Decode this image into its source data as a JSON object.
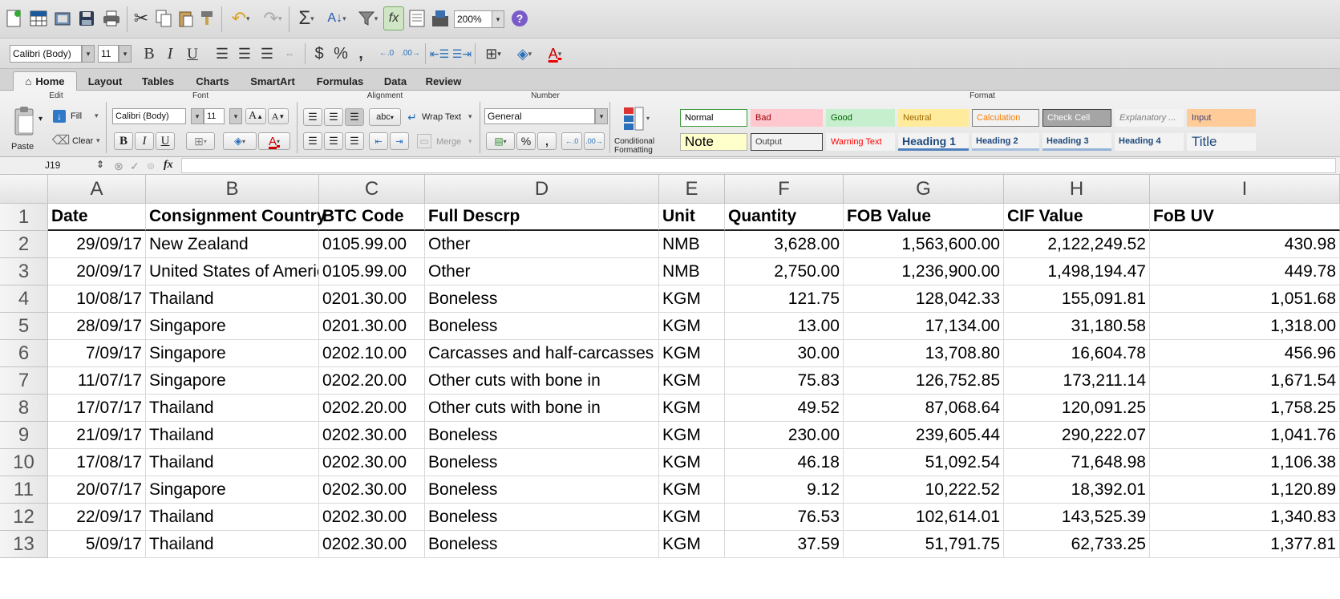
{
  "toolbar": {
    "zoom": "200%",
    "icons": [
      "new-doc-icon",
      "template-gallery-icon",
      "open-icon",
      "save-icon",
      "print-icon",
      "cut-icon",
      "copy-icon",
      "paste-icon",
      "format-painter-icon",
      "undo-icon",
      "redo-icon",
      "autosum-icon",
      "sort-icon",
      "filter-icon",
      "formula-builder-icon",
      "show-hide-icon",
      "gallery-icon",
      "help-icon"
    ]
  },
  "format_bar": {
    "font_name": "Calibri (Body)",
    "font_size": "11",
    "bold": "B",
    "italic": "I",
    "underline": "U",
    "currency": "$",
    "percent": "%",
    "comma": ",",
    "font_color_glyph": "A"
  },
  "ribbon_tabs": [
    "Home",
    "Layout",
    "Tables",
    "Charts",
    "SmartArt",
    "Formulas",
    "Data",
    "Review"
  ],
  "ribbon": {
    "groups": {
      "edit": "Edit",
      "font": "Font",
      "alignment": "Alignment",
      "number": "Number",
      "format": "Format"
    },
    "paste": "Paste",
    "fill": "Fill",
    "clear": "Clear",
    "font_name": "Calibri (Body)",
    "font_size": "11",
    "wrap_text": "Wrap Text",
    "merge": "Merge",
    "abc": "abc",
    "number_format": "General",
    "conditional_formatting": [
      "Conditional",
      "Formatting"
    ],
    "styles": [
      {
        "label": "Normal",
        "bg": "#ffffff",
        "fg": "#000000",
        "border": "#3a9a3a"
      },
      {
        "label": "Bad",
        "bg": "#ffc7ce",
        "fg": "#9c0006",
        "border": "#ffc7ce"
      },
      {
        "label": "Good",
        "bg": "#c6efce",
        "fg": "#006100",
        "border": "#c6efce"
      },
      {
        "label": "Neutral",
        "bg": "#ffeb9c",
        "fg": "#9c6500",
        "border": "#ffeb9c"
      },
      {
        "label": "Calculation",
        "bg": "#f2f2f2",
        "fg": "#fa7d00",
        "border": "#7f7f7f"
      },
      {
        "label": "Check Cell",
        "bg": "#a5a5a5",
        "fg": "#ffffff",
        "border": "#3f3f3f"
      },
      {
        "label": "Explanatory ...",
        "bg": "#f3f3f3",
        "fg": "#7f7f7f",
        "border": "#f3f3f3"
      },
      {
        "label": "Input",
        "bg": "#ffcc99",
        "fg": "#3f3f76",
        "border": "#ffcc99"
      },
      {
        "label": "Note",
        "bg": "#ffffcc",
        "fg": "#000000",
        "border": "#b2b2b2"
      },
      {
        "label": "Output",
        "bg": "#f2f2f2",
        "fg": "#3f3f3f",
        "border": "#3f3f3f"
      },
      {
        "label": "Warning Text",
        "bg": "#f3f3f3",
        "fg": "#ff0000",
        "border": "#f3f3f3"
      },
      {
        "label": "Heading 1",
        "bg": "#f3f3f3",
        "fg": "#1f497d",
        "border": "#4f81bd"
      },
      {
        "label": "Heading 2",
        "bg": "#f3f3f3",
        "fg": "#1f497d",
        "border": "#a7bfde"
      },
      {
        "label": "Heading 3",
        "bg": "#f3f3f3",
        "fg": "#1f497d",
        "border": "#95b3d7"
      },
      {
        "label": "Heading 4",
        "bg": "#f3f3f3",
        "fg": "#1f497d",
        "border": "#f3f3f3"
      },
      {
        "label": "Title",
        "bg": "#f3f3f3",
        "fg": "#1f497d",
        "border": "#f3f3f3"
      }
    ]
  },
  "formula_bar": {
    "cell_ref": "J19",
    "fx": "fx",
    "formula": ""
  },
  "sheet": {
    "columns": [
      "A",
      "B",
      "C",
      "D",
      "E",
      "F",
      "G",
      "H",
      "I"
    ],
    "rows": [
      {
        "n": "1",
        "cells": [
          "Date",
          "Consignment Country",
          "BTC Code",
          "Full Descrp",
          "Unit",
          "Quantity",
          "FOB Value",
          "CIF Value",
          "FoB UV"
        ]
      },
      {
        "n": "2",
        "cells": [
          "29/09/17",
          "New Zealand",
          "0105.99.00",
          "Other",
          "NMB",
          "3,628.00",
          "1,563,600.00",
          "2,122,249.52",
          "430.98"
        ]
      },
      {
        "n": "3",
        "cells": [
          "20/09/17",
          "United States of Americ",
          "0105.99.00",
          "Other",
          "NMB",
          "2,750.00",
          "1,236,900.00",
          "1,498,194.47",
          "449.78"
        ]
      },
      {
        "n": "4",
        "cells": [
          "10/08/17",
          "Thailand",
          "0201.30.00",
          "Boneless",
          "KGM",
          "121.75",
          "128,042.33",
          "155,091.81",
          "1,051.68"
        ]
      },
      {
        "n": "5",
        "cells": [
          "28/09/17",
          "Singapore",
          "0201.30.00",
          "Boneless",
          "KGM",
          "13.00",
          "17,134.00",
          "31,180.58",
          "1,318.00"
        ]
      },
      {
        "n": "6",
        "cells": [
          "7/09/17",
          "Singapore",
          "0202.10.00",
          "Carcasses and half-carcasses",
          "KGM",
          "30.00",
          "13,708.80",
          "16,604.78",
          "456.96"
        ]
      },
      {
        "n": "7",
        "cells": [
          "11/07/17",
          "Singapore",
          "0202.20.00",
          "Other cuts with bone in",
          "KGM",
          "75.83",
          "126,752.85",
          "173,211.14",
          "1,671.54"
        ]
      },
      {
        "n": "8",
        "cells": [
          "17/07/17",
          "Thailand",
          "0202.20.00",
          "Other cuts with bone in",
          "KGM",
          "49.52",
          "87,068.64",
          "120,091.25",
          "1,758.25"
        ]
      },
      {
        "n": "9",
        "cells": [
          "21/09/17",
          "Thailand",
          "0202.30.00",
          "Boneless",
          "KGM",
          "230.00",
          "239,605.44",
          "290,222.07",
          "1,041.76"
        ]
      },
      {
        "n": "10",
        "cells": [
          "17/08/17",
          "Thailand",
          "0202.30.00",
          "Boneless",
          "KGM",
          "46.18",
          "51,092.54",
          "71,648.98",
          "1,106.38"
        ]
      },
      {
        "n": "11",
        "cells": [
          "20/07/17",
          "Singapore",
          "0202.30.00",
          "Boneless",
          "KGM",
          "9.12",
          "10,222.52",
          "18,392.01",
          "1,120.89"
        ]
      },
      {
        "n": "12",
        "cells": [
          "22/09/17",
          "Thailand",
          "0202.30.00",
          "Boneless",
          "KGM",
          "76.53",
          "102,614.01",
          "143,525.39",
          "1,340.83"
        ]
      },
      {
        "n": "13",
        "cells": [
          "5/09/17",
          "Thailand",
          "0202.30.00",
          "Boneless",
          "KGM",
          "37.59",
          "51,791.75",
          "62,733.25",
          "1,377.81"
        ]
      }
    ]
  }
}
